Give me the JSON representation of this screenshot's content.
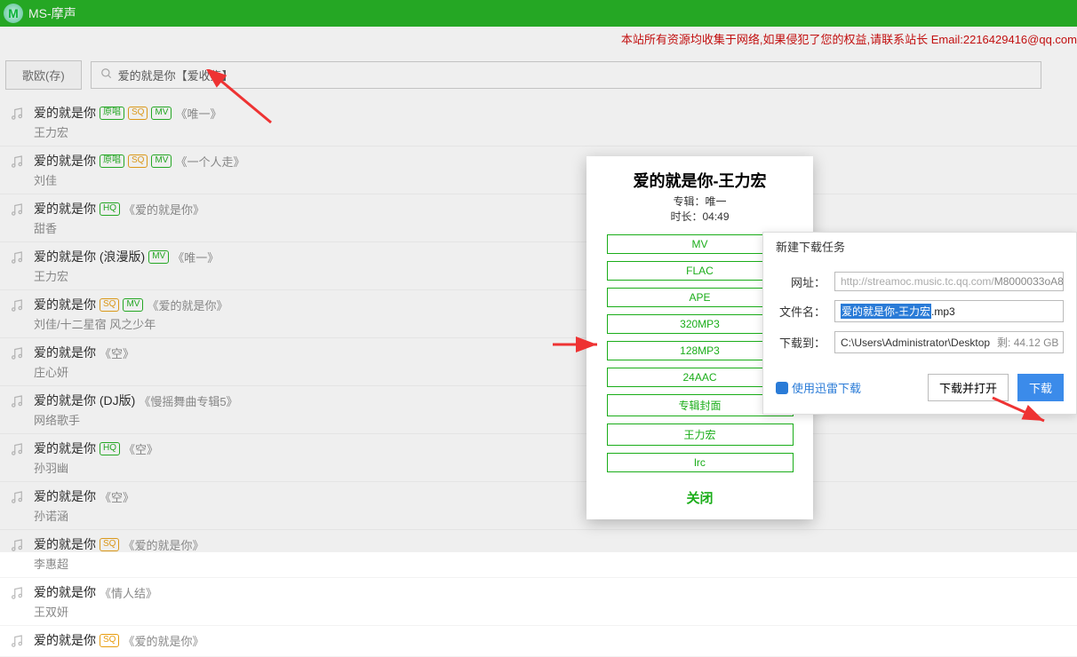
{
  "header": {
    "logo_letter": "M",
    "title": "MS-摩声"
  },
  "disclaimer": "本站所有资源均收集于网络,如果侵犯了您的权益,请联系站长 Email:2216429416@qq.com",
  "toolbar": {
    "singer_btn": "歌欧(存)",
    "search_value": "爱的就是你【爱收集】"
  },
  "tracks": [
    {
      "title": "爱的就是你",
      "badges": [
        "原唱",
        "SQ",
        "MV"
      ],
      "album": "《唯一》",
      "artist": "王力宏"
    },
    {
      "title": "爱的就是你",
      "badges": [
        "原唱",
        "SQ",
        "MV"
      ],
      "album": "《一个人走》",
      "artist": "刘佳"
    },
    {
      "title": "爱的就是你",
      "badges": [
        "HQ"
      ],
      "album": "《爱的就是你》",
      "artist": "甜香"
    },
    {
      "title": "爱的就是你 (浪漫版)",
      "badges": [
        "MV"
      ],
      "album": "《唯一》",
      "artist": "王力宏"
    },
    {
      "title": "爱的就是你",
      "badges": [
        "SQ",
        "MV"
      ],
      "album": "《爱的就是你》",
      "artist": "刘佳/十二星宿 风之少年"
    },
    {
      "title": "爱的就是你",
      "badges": [],
      "album": "《空》",
      "artist": "庄心妍"
    },
    {
      "title": "爱的就是你 (DJ版)",
      "badges": [],
      "album": "《慢摇舞曲专辑5》",
      "artist": "网络歌手"
    },
    {
      "title": "爱的就是你",
      "badges": [
        "HQ"
      ],
      "album": "《空》",
      "artist": "孙羽幽"
    },
    {
      "title": "爱的就是你",
      "badges": [],
      "album": "《空》",
      "artist": "孙诺涵"
    },
    {
      "title": "爱的就是你",
      "badges": [
        "SQ"
      ],
      "album": "《爱的就是你》",
      "artist": "李惠超"
    },
    {
      "title": "爱的就是你",
      "badges": [],
      "album": "《情人结》",
      "artist": "王双妍"
    },
    {
      "title": "爱的就是你",
      "badges": [
        "SQ"
      ],
      "album": "《爱的就是你》",
      "artist": ""
    }
  ],
  "modal": {
    "title": "爱的就是你-王力宏",
    "album_label": "专辑：唯一",
    "duration_label": "时长：04:49",
    "options": [
      "MV",
      "FLAC",
      "APE",
      "320MP3",
      "128MP3",
      "24AAC",
      "专辑封面",
      "王力宏",
      "lrc"
    ],
    "close": "关闭"
  },
  "download_dialog": {
    "title": "新建下载任务",
    "url_label": "网址：",
    "url_value_prefix": "http://streamoc.music.tc.qq.com/",
    "url_value_suffix": "M8000033oA8",
    "file_label": "文件名：",
    "file_selected": "爱的就是你-王力宏",
    "file_ext": ".mp3",
    "dest_label": "下载到：",
    "dest_value": "C:\\Users\\Administrator\\Desktop",
    "remaining": "剩: 44.12 GB",
    "xunlei": "使用迅雷下载",
    "open_btn": "下载并打开",
    "dl_btn": "下载"
  }
}
